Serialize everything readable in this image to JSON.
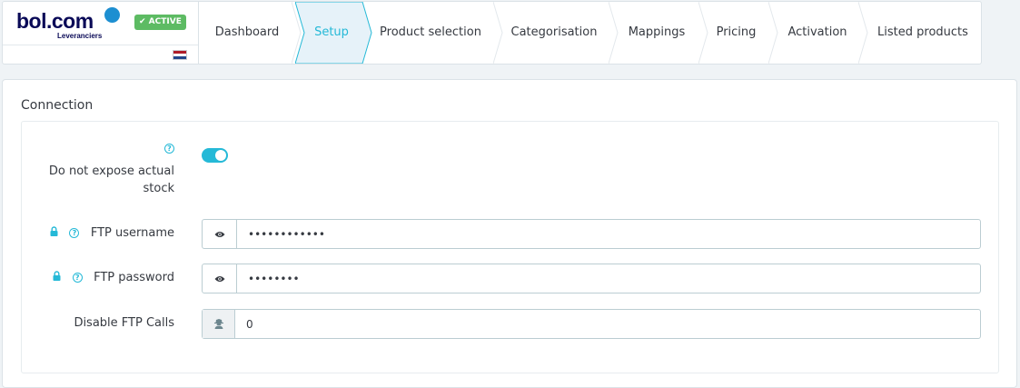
{
  "brand": {
    "logo_text": "bol.com",
    "logo_sub": "Leveranciers",
    "status_badge": "✔ ACTIVE"
  },
  "tabs": [
    {
      "label": "Dashboard",
      "active": false
    },
    {
      "label": "Setup",
      "active": true
    },
    {
      "label": "Product selection",
      "active": false
    },
    {
      "label": "Categorisation",
      "active": false
    },
    {
      "label": "Mappings",
      "active": false
    },
    {
      "label": "Pricing",
      "active": false
    },
    {
      "label": "Activation",
      "active": false
    },
    {
      "label": "Listed products",
      "active": false
    }
  ],
  "panel": {
    "title": "Connection",
    "stock_toggle_label_line1": "Do not expose actual",
    "stock_toggle_label_line2": "stock",
    "stock_toggle_on": true,
    "ftp_username_label": "FTP username",
    "ftp_username_value": "••••••••••••",
    "ftp_password_label": "FTP password",
    "ftp_password_value": "••••••••",
    "disable_ftp_label": "Disable FTP Calls",
    "disable_ftp_value": "0"
  },
  "colors": {
    "accent": "#25b9d7",
    "badge": "#5dbb63",
    "brand_navy": "#0a0a57"
  },
  "icons": {
    "help": "question-circle-icon",
    "lock": "lock-icon",
    "eye": "eye-icon",
    "user_secret": "user-secret-icon"
  }
}
